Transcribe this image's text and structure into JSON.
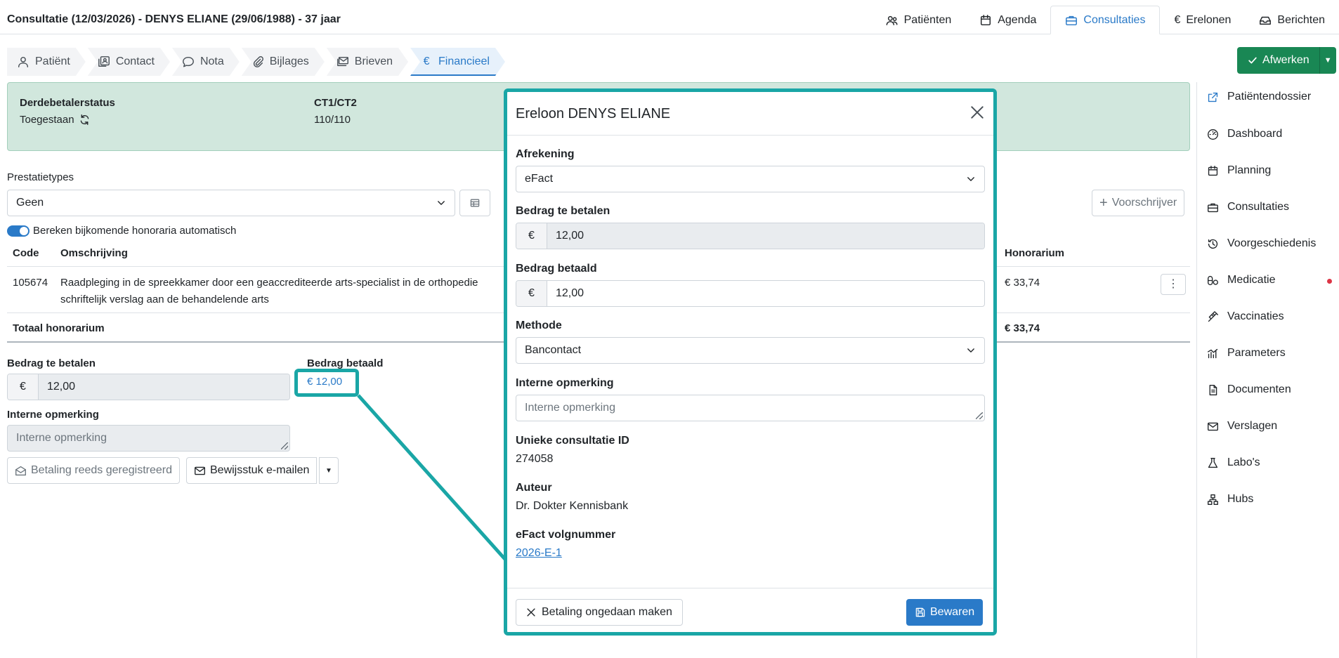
{
  "header": {
    "title": "Consultatie (12/03/2026) - DENYS ELIANE (29/06/1988) - 37 jaar"
  },
  "topnav": [
    {
      "label": "Patiënten",
      "icon": "users-icon"
    },
    {
      "label": "Agenda",
      "icon": "calendar-icon"
    },
    {
      "label": "Consultaties",
      "icon": "briefcase-icon",
      "active": true
    },
    {
      "label": "Erelonen",
      "icon": "euro-icon"
    },
    {
      "label": "Berichten",
      "icon": "inbox-icon"
    }
  ],
  "subtabs": [
    {
      "label": "Patiënt",
      "icon": "person-icon"
    },
    {
      "label": "Contact",
      "icon": "contact-icon"
    },
    {
      "label": "Nota",
      "icon": "chat-icon"
    },
    {
      "label": "Bijlages",
      "icon": "paperclip-icon"
    },
    {
      "label": "Brieven",
      "icon": "letters-icon"
    },
    {
      "label": "Financieel",
      "icon": "euro-icon",
      "active": true
    }
  ],
  "afwerken": {
    "label": "Afwerken"
  },
  "status": {
    "derdebetaler_label": "Derdebetalerstatus",
    "derdebetaler_value": "Toegestaan",
    "ct_label": "CT1/CT2",
    "ct_value": "110/110"
  },
  "prestatie": {
    "label": "Prestatietypes",
    "selected": "Geen",
    "voorschrijver_label": "Voorschrijver",
    "toggle_label": "Bereken bijkomende honoraria automatisch"
  },
  "table": {
    "headers": {
      "code": "Code",
      "omschrijving": "Omschrijving",
      "honorarium": "Honorarium"
    },
    "rows": [
      {
        "code": "105674",
        "omschrijving_line1": "Raadpleging in de spreekkamer door een geaccrediteerde arts-specialist in de orthopedie",
        "omschrijving_line2": "schriftelijk verslag aan de behandelende arts",
        "honorarium": "€ 33,74"
      }
    ],
    "total_label": "Totaal honorarium",
    "total_value": "€ 33,74"
  },
  "payment": {
    "te_betalen_label": "Bedrag te betalen",
    "currency": "€",
    "te_betalen_value": "12,00",
    "betaald_label": "Bedrag betaald",
    "betaald_link": "€ 12,00",
    "opmerking_label": "Interne opmerking",
    "opmerking_placeholder": "Interne opmerking",
    "reeds_label": "Betaling reeds geregistreerd",
    "email_label": "Bewijsstuk e-mailen"
  },
  "sidebar": [
    {
      "label": "Patiëntendossier",
      "icon": "external-link-icon",
      "color": "#2a7ac8"
    },
    {
      "label": "Dashboard",
      "icon": "dashboard-icon"
    },
    {
      "label": "Planning",
      "icon": "calendar-icon"
    },
    {
      "label": "Consultaties",
      "icon": "briefcase-icon"
    },
    {
      "label": "Voorgeschiedenis",
      "icon": "history-icon"
    },
    {
      "label": "Medicatie",
      "icon": "pills-icon",
      "badge_color": "#dc3545"
    },
    {
      "label": "Vaccinaties",
      "icon": "syringe-icon"
    },
    {
      "label": "Parameters",
      "icon": "chart-icon"
    },
    {
      "label": "Documenten",
      "icon": "document-icon"
    },
    {
      "label": "Verslagen",
      "icon": "envelope-icon"
    },
    {
      "label": "Labo's",
      "icon": "flask-icon"
    },
    {
      "label": "Hubs",
      "icon": "hubs-icon"
    }
  ],
  "modal": {
    "title": "Ereloon DENYS ELIANE",
    "afrekening_label": "Afrekening",
    "afrekening_value": "eFact",
    "te_betalen_label": "Bedrag te betalen",
    "te_betalen_value": "12,00",
    "betaald_label": "Bedrag betaald",
    "betaald_value": "12,00",
    "methode_label": "Methode",
    "methode_value": "Bancontact",
    "opmerking_label": "Interne opmerking",
    "opmerking_placeholder": "Interne opmerking",
    "id_label": "Unieke consultatie ID",
    "id_value": "274058",
    "auteur_label": "Auteur",
    "auteur_value": "Dr. Dokter Kennisbank",
    "volgnummer_label": "eFact volgnummer",
    "volgnummer_value": "2026-E-1",
    "undo_label": "Betaling ongedaan maken",
    "save_label": "Bewaren"
  },
  "colors": {
    "accent": "#2a7ac8",
    "highlight": "#1aa6a6",
    "success": "#198754",
    "status_bg": "#d1e7dd"
  }
}
